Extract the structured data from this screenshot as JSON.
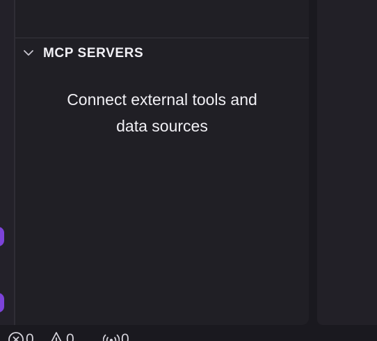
{
  "mcp_section": {
    "title": "MCP SERVERS",
    "empty_message_line1": "Connect external tools and",
    "empty_message_line2": "data sources",
    "chevron_icon": "chevron-down-icon"
  },
  "status_bar": {
    "errors_count": "0",
    "warnings_count": "0",
    "broadcast_count": "0"
  },
  "colors": {
    "accent": "#7c43d8",
    "panel_bg": "#201f25",
    "app_bg": "#1a191f",
    "text": "#f1f0f5"
  }
}
